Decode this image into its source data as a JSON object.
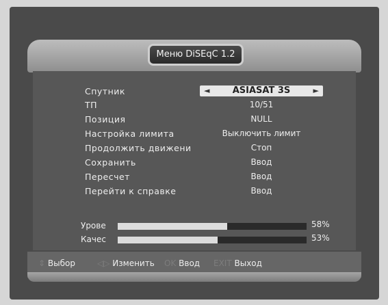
{
  "title": "Меню DiSEqC 1.2",
  "rows": [
    {
      "label": "Спутник",
      "value": "ASIASAT 3S"
    },
    {
      "label": "ТП",
      "value": "10/51"
    },
    {
      "label": "Позиция",
      "value": "NULL"
    },
    {
      "label": "Настройка лимита",
      "value": "Выключить лимит"
    },
    {
      "label": "Продолжить движени",
      "value": "Стоп"
    },
    {
      "label": "Сохранить",
      "value": "Ввод"
    },
    {
      "label": "Пересчет",
      "value": "Ввод"
    },
    {
      "label": "Перейти к справке",
      "value": "Ввод"
    }
  ],
  "signal": {
    "level": {
      "label": "Урове",
      "percent_text": "58%",
      "fraction": 0.58
    },
    "quality": {
      "label": "Качес",
      "percent_text": "53%",
      "fraction": 0.53
    }
  },
  "footer": {
    "select": {
      "key": "⇕",
      "label": "Выбор"
    },
    "change": {
      "key": "◁▷",
      "label": "Изменить"
    },
    "enter": {
      "key": "OK",
      "label": "Ввод"
    },
    "exit": {
      "key": "EXIT",
      "label": "Выход"
    }
  }
}
